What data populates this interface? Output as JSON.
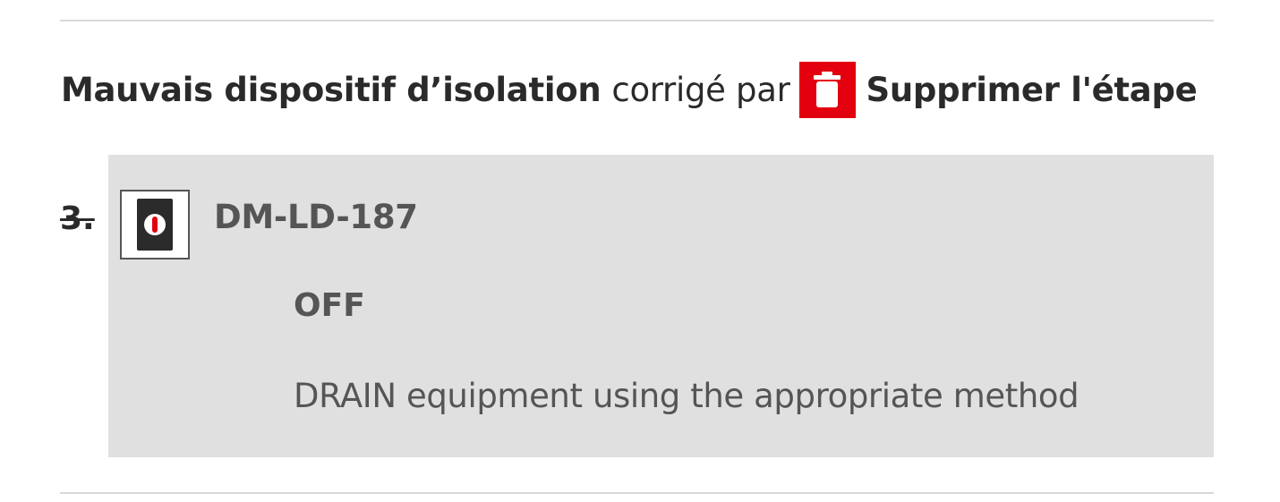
{
  "correction": {
    "issue_title": "Mauvais dispositif d’isolation",
    "connector": "corrigé par",
    "action_label": "Supprimer l'étape",
    "action_icon": "trash-icon",
    "action_color": "#e3000f"
  },
  "step": {
    "number": "3.",
    "device_icon": "switch-off-icon",
    "device_id": "DM-LD-187",
    "state": "OFF",
    "instruction": "DRAIN equipment using the appropriate method",
    "panel_color": "#e0e0e0"
  }
}
